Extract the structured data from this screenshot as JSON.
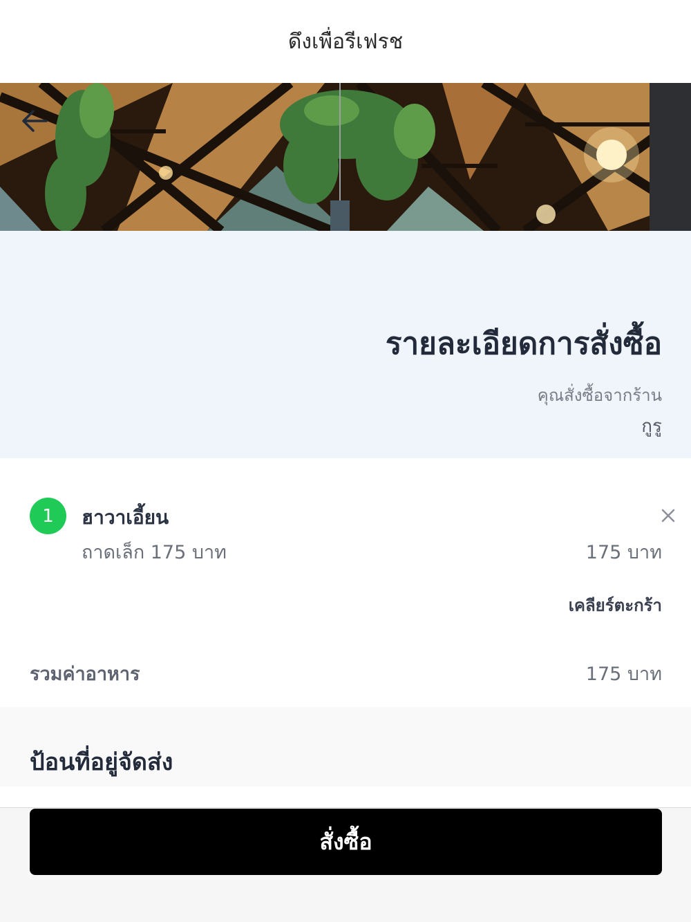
{
  "pull_refresh": {
    "text": "ดึงเพื่อรีเฟรช"
  },
  "summary": {
    "title": "รายละเอียดการสั่งซื้อ",
    "ordered_from_label": "คุณสั่งซื้อจากร้าน",
    "shop_name": "กูรู"
  },
  "cart": {
    "items": [
      {
        "qty": "1",
        "name": "ฮาวาเอี้ยน",
        "option": "ถาดเล็ก 175 บาท",
        "price": "175 บาท"
      }
    ],
    "clear_label": "เคลียร์ตะกร้า",
    "subtotal_label": "รวมค่าอาหาร",
    "subtotal_value": "175 บาท"
  },
  "address": {
    "title": "ป้อนที่อยู่จัดส่ง"
  },
  "order_button": {
    "label": "สั่งซื้อ"
  },
  "colors": {
    "badge": "#1fcb56",
    "button": "#000000",
    "header_bg": "#f0f4fb"
  },
  "icons": {
    "back": "arrow-left-icon",
    "remove": "close-icon"
  }
}
